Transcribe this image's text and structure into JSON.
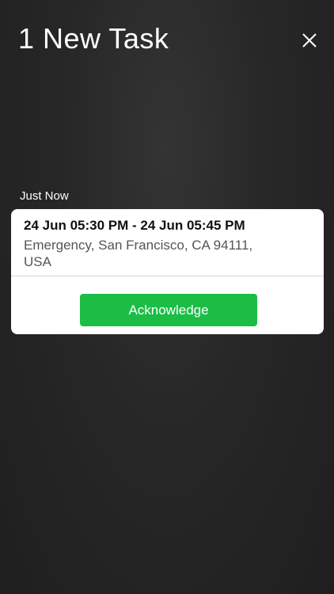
{
  "header": {
    "title": "1 New Task",
    "close_icon": "close-icon"
  },
  "section": {
    "label": "Just Now"
  },
  "task": {
    "time_range": "24 Jun 05:30 PM - 24 Jun 05:45 PM",
    "location": "Emergency, San Francisco, CA 94111, USA",
    "acknowledge_label": "Acknowledge"
  },
  "colors": {
    "background": "#272727",
    "card": "#ffffff",
    "accent_green": "#1bbd45"
  }
}
